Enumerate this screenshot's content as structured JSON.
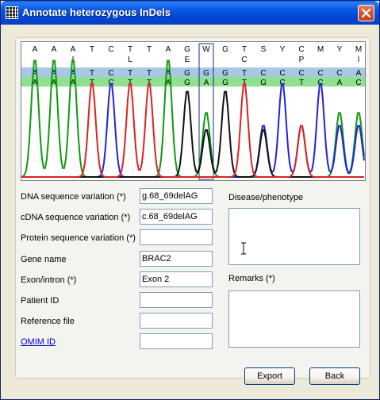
{
  "window": {
    "title": "Annotate heterozygous InDels"
  },
  "chromatogram": {
    "rows": [
      [
        "A",
        "A",
        "A",
        "T",
        "C",
        "T",
        "T",
        "A",
        "G",
        "W",
        "G",
        "T",
        "S",
        "Y",
        "C",
        "M",
        "Y",
        "M"
      ],
      [
        "",
        "",
        "I",
        "",
        "",
        "L",
        "",
        "",
        "E",
        "",
        "",
        "C",
        "",
        "",
        "P",
        "",
        "",
        "I"
      ],
      [
        "A",
        "A",
        "A",
        "T",
        "C",
        "T",
        "T",
        "A",
        "G",
        "G",
        "G",
        "T",
        "C",
        "C",
        "C",
        "C",
        "C",
        "A"
      ],
      [
        "A",
        "A",
        "A",
        "T",
        "C",
        "T",
        "T",
        "A",
        "G",
        "A",
        "G",
        "T",
        "G",
        "C",
        "T",
        "C",
        "A",
        "C"
      ]
    ],
    "trace_colors": {
      "A": "#119911",
      "C": "#2222dd",
      "G": "#111111",
      "T": "#dd2222"
    },
    "band_colors": {
      "row3": "#a8c8e8",
      "row4": "#90e090"
    }
  },
  "form": {
    "fields": [
      {
        "label": "DNA sequence variation (*)",
        "value": "g.68_69delAG"
      },
      {
        "label": "cDNA sequence variation (*)",
        "value": "c.68_69delAG"
      },
      {
        "label": "Protein sequence variation (*)",
        "value": ""
      },
      {
        "label": "Gene name",
        "value": "BRAC2"
      },
      {
        "label": "Exon/intron (*)",
        "value": "Exon 2"
      },
      {
        "label": "Patient ID",
        "value": ""
      },
      {
        "label": "Reference file",
        "value": ""
      },
      {
        "label": "OMIM ID",
        "value": ""
      }
    ],
    "disease_label": "Disease/phenotype",
    "disease_value": "",
    "remarks_label": "Remarks (*)",
    "remarks_value": ""
  },
  "buttons": {
    "export": "Export",
    "back": "Back"
  }
}
